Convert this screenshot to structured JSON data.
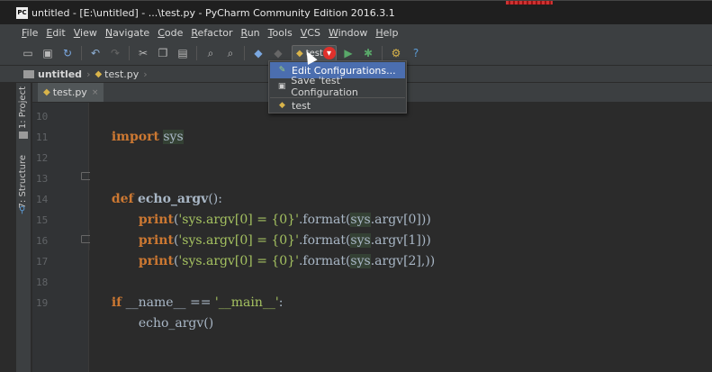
{
  "window": {
    "app_icon": "PC",
    "title": "untitled - [E:\\untitled] - ...\\test.py - PyCharm Community Edition 2016.3.1"
  },
  "menu": [
    "File",
    "Edit",
    "View",
    "Navigate",
    "Code",
    "Refactor",
    "Run",
    "Tools",
    "VCS",
    "Window",
    "Help"
  ],
  "toolbar": {
    "icons": [
      "open-folder-icon",
      "save-icon",
      "sync-icon",
      "undo-icon",
      "redo-icon",
      "cut-icon",
      "copy-icon",
      "paste-icon",
      "find-icon",
      "replace-icon",
      "back-icon",
      "forward-icon",
      "run-icon",
      "debug-icon",
      "settings-icon",
      "help-icon"
    ],
    "run_config_label": "test"
  },
  "breadcrumb": {
    "project": "untitled",
    "file": "test.py"
  },
  "side_tools": {
    "project_label": "1: Project",
    "structure_label": "7: Structure"
  },
  "editor_tab": {
    "label": "test.py",
    "close": "×"
  },
  "dropdown": {
    "items": [
      {
        "label": "Edit Configurations...",
        "icon": "edit-config-icon",
        "selected": true
      },
      {
        "label": "Save 'test' Configuration",
        "icon": "save-config-icon",
        "selected": false
      },
      {
        "label": "test",
        "icon": "python-file-icon",
        "selected": false
      }
    ]
  },
  "code": {
    "line_numbers": [
      "10",
      "11",
      "12",
      "13",
      "14",
      "15",
      "16",
      "17",
      "18",
      "19"
    ],
    "l10": {
      "kw": "import",
      "mod": "sys"
    },
    "l13": {
      "kw": "def",
      "name": "echo_argv",
      "rest": "():"
    },
    "l14": {
      "fn": "print",
      "open": "(",
      "str": "'sys.argv[0] = {0}'",
      "fmt": ".format(",
      "mod": "sys",
      "rest": ".argv[0]))"
    },
    "l15": {
      "fn": "print",
      "open": "(",
      "str": "'sys.argv[0] = {0}'",
      "fmt": ".format(",
      "mod": "sys",
      "rest": ".argv[1]))"
    },
    "l16": {
      "fn": "print",
      "open": "(",
      "str": "'sys.argv[0] = {0}'",
      "fmt": ".format(",
      "mod": "sys",
      "rest": ".argv[2],))"
    },
    "l18": {
      "kw": "if",
      "a": " __name__ == ",
      "str": "'__main__'",
      "rest": ":"
    },
    "l19": {
      "call": "echo_argv()"
    }
  }
}
